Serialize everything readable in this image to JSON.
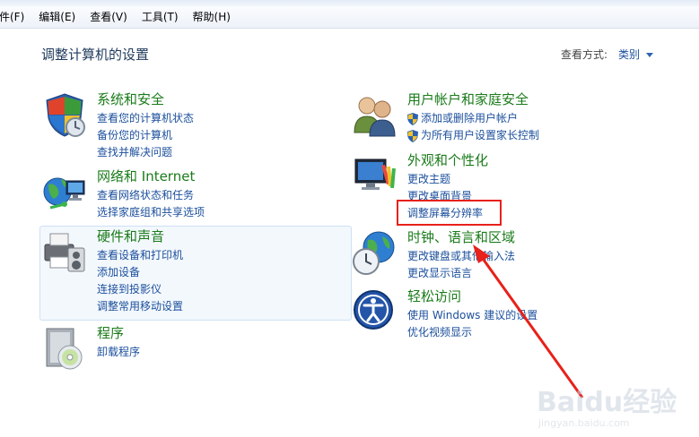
{
  "menubar": {
    "items": [
      "件(F)",
      "编辑(E)",
      "查看(V)",
      "工具(T)",
      "帮助(H)"
    ]
  },
  "main": {
    "title": "调整计算机的设置",
    "view_by": {
      "label": "查看方式:",
      "value": "类别"
    }
  },
  "categories": {
    "system_security": {
      "title": "系统和安全",
      "links": [
        "查看您的计算机状态",
        "备份您的计算机",
        "查找并解决问题"
      ]
    },
    "network": {
      "title": "网络和 Internet",
      "links": [
        "查看网络状态和任务",
        "选择家庭组和共享选项"
      ]
    },
    "hardware_sound": {
      "title": "硬件和声音",
      "links": [
        "查看设备和打印机",
        "添加设备",
        "连接到投影仪",
        "调整常用移动设置"
      ]
    },
    "programs": {
      "title": "程序",
      "links": [
        "卸载程序"
      ]
    },
    "user_accounts": {
      "title": "用户帐户和家庭安全",
      "links": [
        "添加或删除用户帐户",
        "为所有用户设置家长控制"
      ]
    },
    "appearance": {
      "title": "外观和个性化",
      "links": [
        "更改主题",
        "更改桌面背景",
        "调整屏幕分辨率"
      ]
    },
    "clock_region": {
      "title": "时钟、语言和区域",
      "links": [
        "更改键盘或其他输入法",
        "更改显示语言"
      ]
    },
    "ease_access": {
      "title": "轻松访问",
      "links": [
        "使用 Windows 建议的设置",
        "优化视频显示"
      ]
    }
  },
  "watermark": {
    "logo": "Baidu经验",
    "url": "jingyan.baidu.com"
  },
  "colors": {
    "link": "#1b4f9c",
    "heading": "#1a7b1a",
    "annotation": "#e8211a"
  }
}
